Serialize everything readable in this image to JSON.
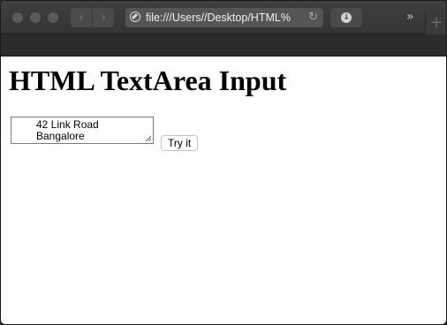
{
  "browser": {
    "url": "file:///Users//Desktop/HTML%",
    "back_glyph": "‹",
    "forward_glyph": "›",
    "reload_glyph": "↻",
    "download_glyph": "↓",
    "overflow_glyph": "»",
    "new_tab_glyph": "+",
    "icons": {
      "site": "compass-icon",
      "reload": "reload-icon",
      "download": "download-icon"
    }
  },
  "page": {
    "title": "HTML TextArea Input",
    "textarea_value": "42 Link Road\nBangalore",
    "button_label": "Try it"
  }
}
